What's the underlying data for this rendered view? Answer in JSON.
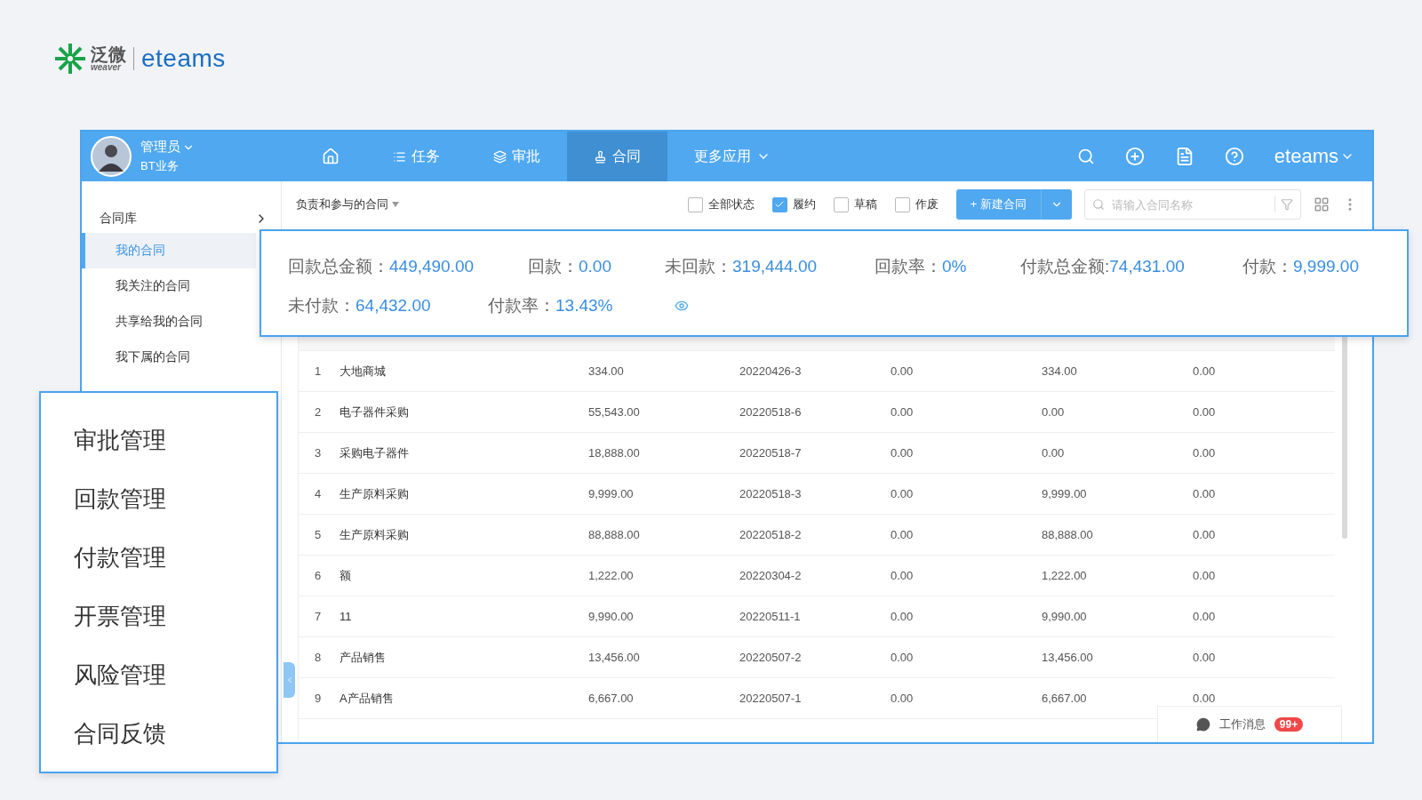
{
  "brand": {
    "logo_cn": "泛微",
    "logo_en": "weaver",
    "product": "eteams"
  },
  "user": {
    "name": "管理员",
    "dept": "BT业务"
  },
  "nav": [
    {
      "kind": "home",
      "selected": false
    },
    {
      "kind": "tasks",
      "label": "任务",
      "selected": false
    },
    {
      "kind": "approval",
      "label": "审批",
      "selected": false
    },
    {
      "kind": "contract",
      "label": "合同",
      "selected": true
    },
    {
      "kind": "more",
      "label": "更多应用",
      "selected": false
    }
  ],
  "workspace": "eteams",
  "sidebar": {
    "section": "合同库",
    "items": [
      {
        "label": "我的合同",
        "selected": true
      },
      {
        "label": "我关注的合同",
        "selected": false
      },
      {
        "label": "共享给我的合同",
        "selected": false
      },
      {
        "label": "我下属的合同",
        "selected": false
      }
    ]
  },
  "toolbar": {
    "scope": "负责和参与的合同",
    "filters": [
      {
        "label": "全部状态",
        "checked": false
      },
      {
        "label": "履约",
        "checked": true
      },
      {
        "label": "草稿",
        "checked": false
      },
      {
        "label": "作废",
        "checked": false
      }
    ],
    "new_button": "+ 新建合同",
    "search": {
      "placeholder": "请输入合同名称"
    }
  },
  "summary": [
    {
      "label": "回款总金额：",
      "value": "449,490.00"
    },
    {
      "label": "回款：",
      "value": "0.00"
    },
    {
      "label": "未回款：",
      "value": "319,444.00"
    },
    {
      "label": "回款率：",
      "value": "0%"
    },
    {
      "label": "付款总金额:",
      "value": "74,431.00"
    },
    {
      "label": "付款：",
      "value": "9,999.00"
    },
    {
      "label": "未付款：",
      "value": "64,432.00"
    },
    {
      "label": "付款率：",
      "value": "13.43%"
    }
  ],
  "table": {
    "rows": [
      {
        "index": "1",
        "cells": [
          "大地商城",
          "334.00",
          "20220426-3",
          "0.00",
          "334.00",
          "0.00"
        ]
      },
      {
        "index": "2",
        "cells": [
          "电子器件采购",
          "55,543.00",
          "20220518-6",
          "0.00",
          "0.00",
          "0.00"
        ]
      },
      {
        "index": "3",
        "cells": [
          "采购电子器件",
          "18,888.00",
          "20220518-7",
          "0.00",
          "0.00",
          "0.00"
        ]
      },
      {
        "index": "4",
        "cells": [
          "生产原料采购",
          "9,999.00",
          "20220518-3",
          "0.00",
          "9,999.00",
          "0.00"
        ]
      },
      {
        "index": "5",
        "cells": [
          "生产原料采购",
          "88,888.00",
          "20220518-2",
          "0.00",
          "88,888.00",
          "0.00"
        ]
      },
      {
        "index": "6",
        "cells": [
          "额",
          "1,222.00",
          "20220304-2",
          "0.00",
          "1,222.00",
          "0.00"
        ]
      },
      {
        "index": "7",
        "cells": [
          "11",
          "9,990.00",
          "20220511-1",
          "0.00",
          "9,990.00",
          "0.00"
        ]
      },
      {
        "index": "8",
        "cells": [
          "产品销售",
          "13,456.00",
          "20220507-2",
          "0.00",
          "13,456.00",
          "0.00"
        ]
      },
      {
        "index": "9",
        "cells": [
          "A产品销售",
          "6,667.00",
          "20220507-1",
          "0.00",
          "6,667.00",
          "0.00"
        ]
      }
    ]
  },
  "callout": {
    "items": [
      "审批管理",
      "回款管理",
      "付款管理",
      "开票管理",
      "风险管理",
      "合同反馈"
    ]
  },
  "messages": {
    "label": "工作消息",
    "badge": "99+"
  }
}
